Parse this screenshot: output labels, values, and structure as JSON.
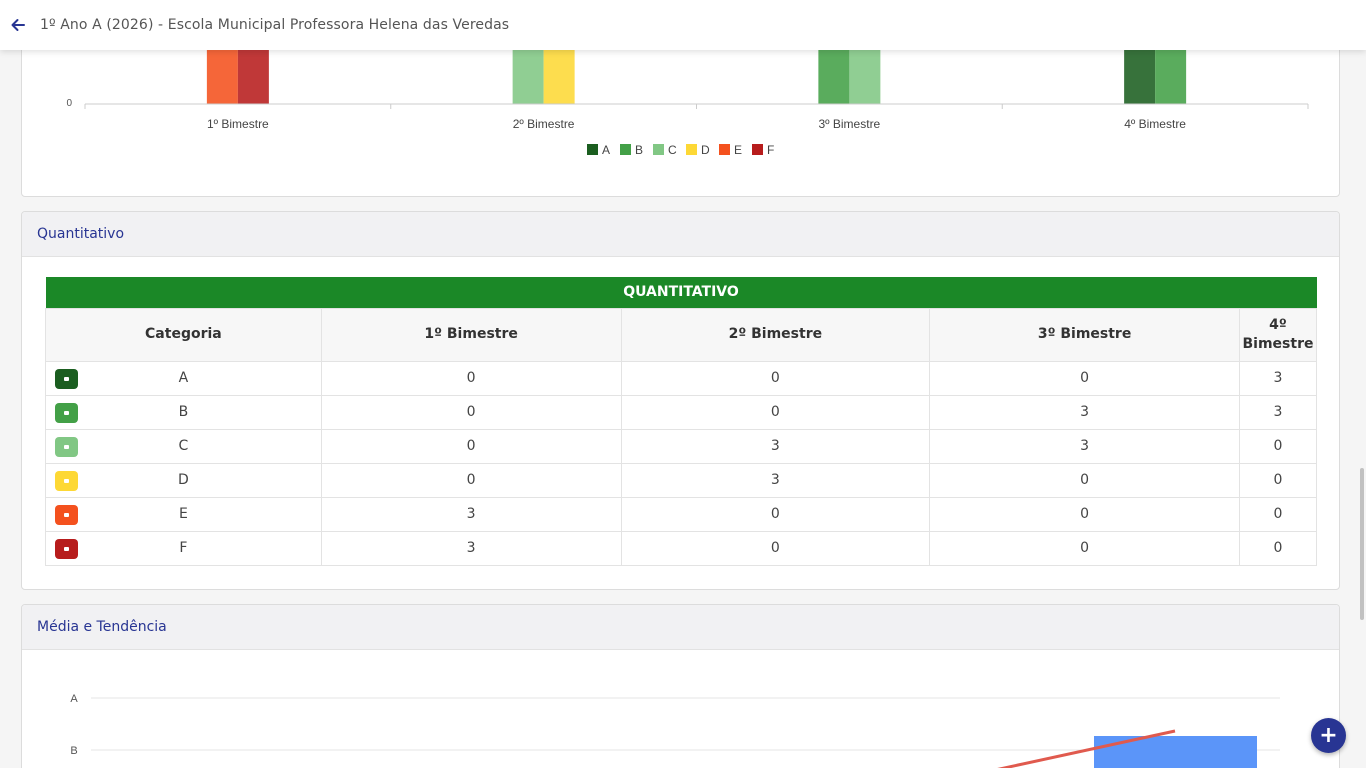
{
  "header": {
    "title": "1º Ano A (2026) - Escola Municipal Professora Helena das Veredas",
    "back_icon": "arrow-left-icon"
  },
  "colors": {
    "A": "#1b5e20",
    "B": "#43a047",
    "C": "#81c784",
    "D": "#fdd835",
    "E": "#f4511e",
    "F": "#b71c1c",
    "banner": "#1b8827",
    "accent": "#283593"
  },
  "chart_data": [
    {
      "type": "bar",
      "y_tick_visible": "0",
      "categories": [
        "1º Bimestre",
        "2º Bimestre",
        "3º Bimestre",
        "4º Bimestre"
      ],
      "series": [
        {
          "name": "A",
          "values": [
            0,
            0,
            0,
            3
          ]
        },
        {
          "name": "B",
          "values": [
            0,
            0,
            3,
            3
          ]
        },
        {
          "name": "C",
          "values": [
            0,
            3,
            3,
            0
          ]
        },
        {
          "name": "D",
          "values": [
            0,
            3,
            0,
            0
          ]
        },
        {
          "name": "E",
          "values": [
            3,
            0,
            0,
            0
          ]
        },
        {
          "name": "F",
          "values": [
            3,
            0,
            0,
            0
          ]
        }
      ],
      "legend": [
        "A",
        "B",
        "C",
        "D",
        "E",
        "F"
      ],
      "legend_position": "bottom"
    }
  ],
  "quantitativo": {
    "section_title": "Quantitativo",
    "banner": "QUANTITATIVO",
    "headers": [
      "Categoria",
      "1º Bimestre",
      "2º Bimestre",
      "3º Bimestre",
      "4º Bimestre"
    ],
    "rows": [
      {
        "cat": "A",
        "v": [
          "0",
          "0",
          "0",
          "3"
        ]
      },
      {
        "cat": "B",
        "v": [
          "0",
          "0",
          "3",
          "3"
        ]
      },
      {
        "cat": "C",
        "v": [
          "0",
          "3",
          "3",
          "0"
        ]
      },
      {
        "cat": "D",
        "v": [
          "0",
          "3",
          "0",
          "0"
        ]
      },
      {
        "cat": "E",
        "v": [
          "3",
          "0",
          "0",
          "0"
        ]
      },
      {
        "cat": "F",
        "v": [
          "3",
          "0",
          "0",
          "0"
        ]
      }
    ]
  },
  "media": {
    "section_title": "Média e Tendência",
    "y_ticks": [
      "A",
      "B"
    ]
  },
  "fab": {
    "icon": "plus-icon",
    "label": "+"
  }
}
